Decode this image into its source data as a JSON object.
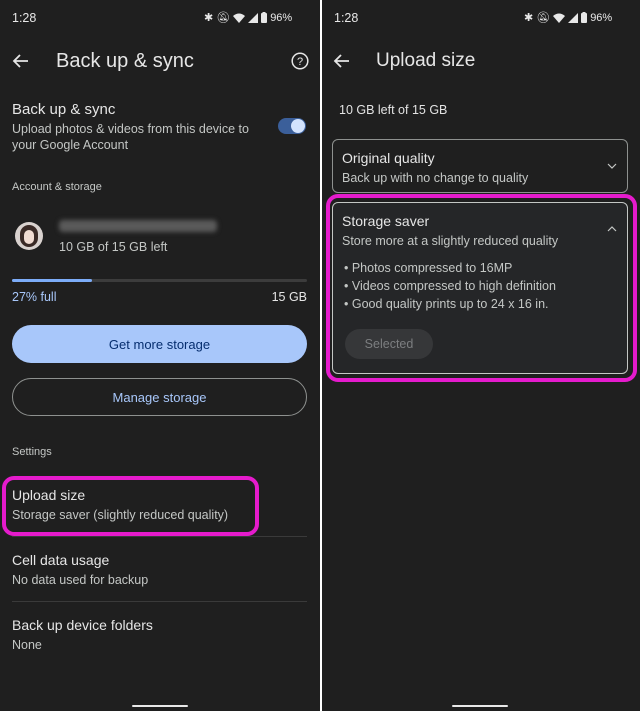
{
  "left": {
    "status": {
      "time": "1:28",
      "battery": "96%"
    },
    "header": {
      "title": "Back up & sync"
    },
    "backup": {
      "title": "Back up & sync",
      "description": "Upload photos & videos from this device to your Google Account",
      "toggle_on": true
    },
    "account": {
      "section_label": "Account & storage",
      "email": "",
      "storage_left": "10 GB of 15 GB left",
      "used_percent_label": "27% full",
      "used_fraction": 0.27,
      "total": "15 GB"
    },
    "buttons": {
      "get_more": "Get more storage",
      "manage": "Manage storage"
    },
    "settings": {
      "section_label": "Settings",
      "upload_size": {
        "title": "Upload size",
        "value": "Storage saver (slightly reduced quality)"
      },
      "cell_data": {
        "title": "Cell data usage",
        "value": "No data used for backup"
      },
      "device_folders": {
        "title": "Back up device folders",
        "value": "None"
      }
    }
  },
  "right": {
    "status": {
      "time": "1:28",
      "battery": "96%"
    },
    "header": {
      "title": "Upload size"
    },
    "remaining": "10 GB left of 15 GB",
    "options": {
      "original": {
        "title": "Original quality",
        "description": "Back up with no change to quality"
      },
      "saver": {
        "title": "Storage saver",
        "description": "Store more at a slightly reduced quality",
        "bullets": [
          "• Photos compressed to 16MP",
          "• Videos compressed to high definition",
          "• Good quality prints up to 24 x 16 in."
        ],
        "button": "Selected"
      }
    }
  },
  "colors": {
    "accent": "#a8c7fa",
    "highlight": "#e51bcc",
    "background": "#1f1f1f",
    "progress": "#7cacf8"
  }
}
